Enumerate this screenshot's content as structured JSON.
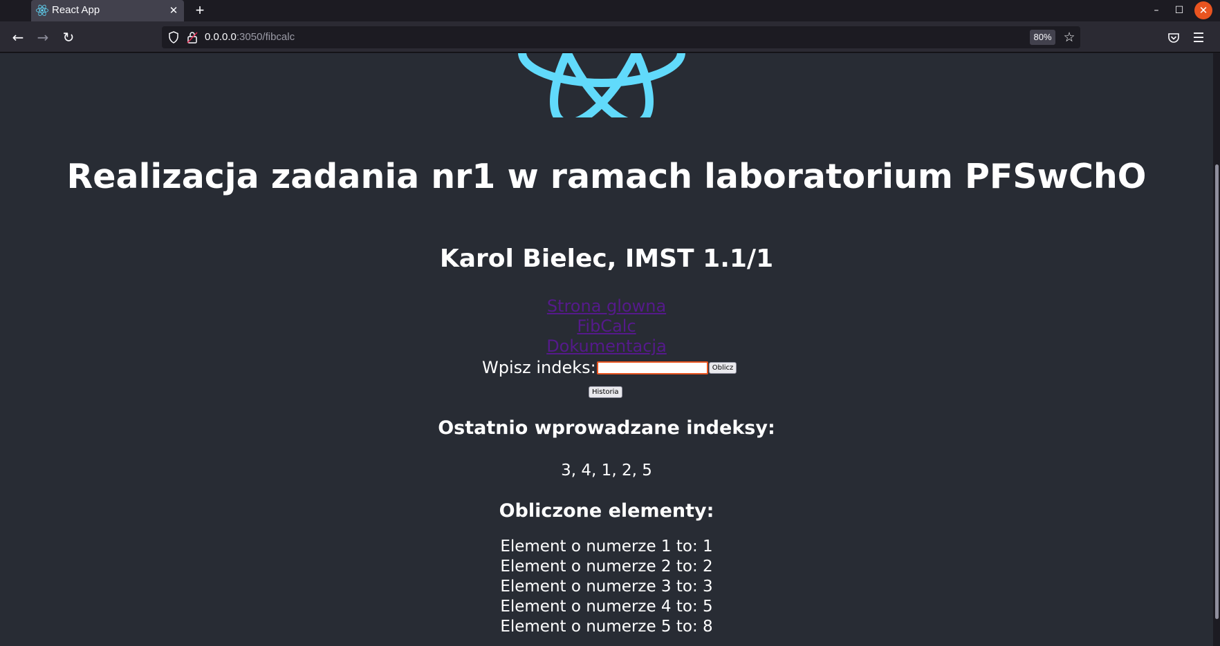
{
  "browser": {
    "tab_title": "React App",
    "url_host": "0.0.0.0",
    "url_rest": ":3050/fibcalc",
    "zoom": "80%"
  },
  "page": {
    "title": "Realizacja zadania nr1 w ramach laboratorium PFSwChO",
    "subtitle": "Karol Bielec, IMST 1.1/1",
    "links": [
      "Strona glowna",
      "FibCalc",
      "Dokumentacja"
    ],
    "form": {
      "label": "Wpisz indeks:",
      "input_value": "",
      "calc_button": "Oblicz",
      "history_button": "Historia"
    },
    "recent_heading": "Ostatnio wprowadzane indeksy:",
    "recent_values": "3, 4, 1, 2, 5",
    "computed_heading": "Obliczone elementy:",
    "results": [
      "Element o numerze 1 to: 1",
      "Element o numerze 2 to: 2",
      "Element o numerze 3 to: 3",
      "Element o numerze 4 to: 5",
      "Element o numerze 5 to: 8"
    ]
  },
  "colors": {
    "page_bg": "#282c34",
    "logo": "#61dafb",
    "link_visited": "#551a8b",
    "accent": "#e95420"
  },
  "icons": [
    "react-logo-icon",
    "close-icon",
    "plus-icon",
    "back-icon",
    "forward-icon",
    "reload-icon",
    "shield-icon",
    "lock-icon",
    "star-icon",
    "pocket-icon",
    "menu-icon",
    "minimize-icon",
    "maximize-icon"
  ]
}
